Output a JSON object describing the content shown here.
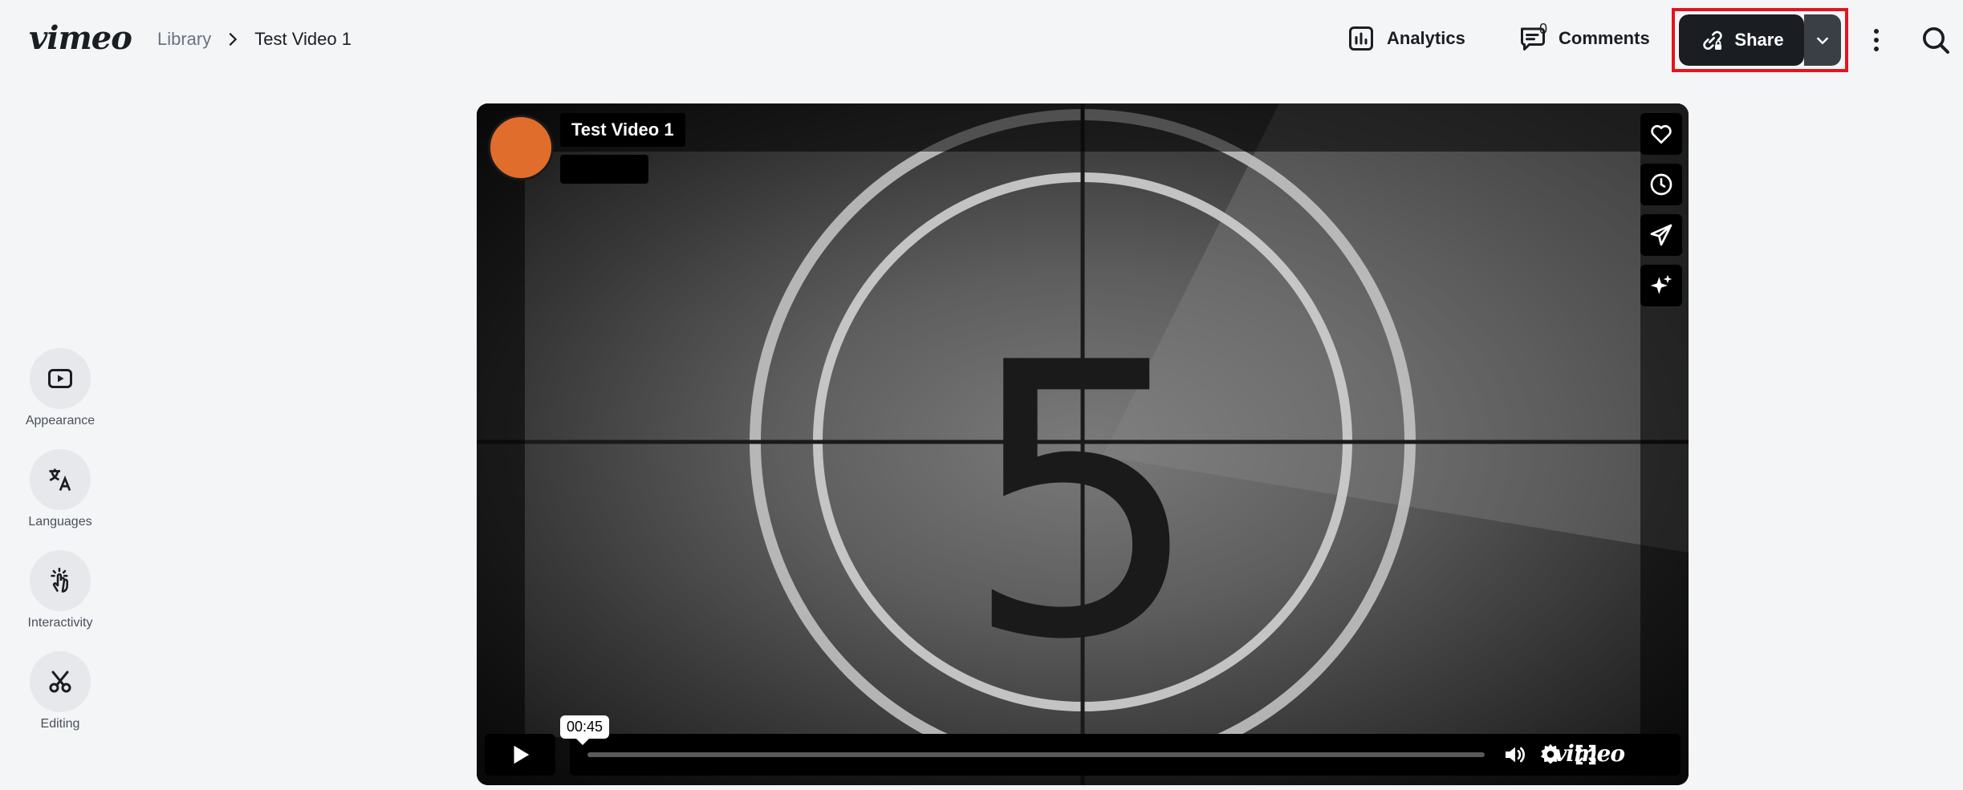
{
  "header": {
    "logo": "vimeo",
    "breadcrumb": {
      "library": "Library",
      "current": "Test Video 1"
    },
    "analytics_label": "Analytics",
    "comments_label": "Comments",
    "comments_count": "0",
    "share_label": "Share"
  },
  "sidebar": {
    "items": [
      {
        "label": "Appearance",
        "icon": "play-square-icon"
      },
      {
        "label": "Languages",
        "icon": "translate-icon"
      },
      {
        "label": "Interactivity",
        "icon": "tap-hand-icon"
      },
      {
        "label": "Editing",
        "icon": "scissors-icon"
      }
    ]
  },
  "player": {
    "title": "Test Video 1",
    "countdown_number": "5",
    "tooltip_time": "00:45",
    "progress": 0.0,
    "brand": "vimeo",
    "accent": "#e06d2b"
  },
  "colors": {
    "highlight": "#e3141e",
    "share_bg": "#1a1e23"
  }
}
